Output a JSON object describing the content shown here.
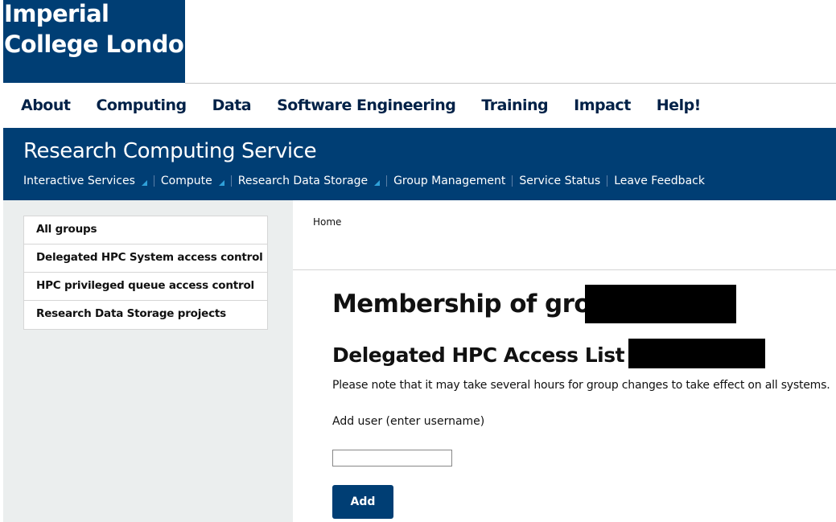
{
  "brand": {
    "logo_line1": "Imperial",
    "logo_line2": "College London",
    "color": "#003e74"
  },
  "main_nav": {
    "items": [
      "About",
      "Computing",
      "Data",
      "Software Engineering",
      "Training",
      "Impact",
      "Help!"
    ]
  },
  "service": {
    "title": "Research Computing Service",
    "subnav": [
      {
        "label": "Interactive Services",
        "dropdown": true
      },
      {
        "label": "Compute",
        "dropdown": true
      },
      {
        "label": "Research Data Storage",
        "dropdown": true
      },
      {
        "label": "Group Management",
        "dropdown": false
      },
      {
        "label": "Service Status",
        "dropdown": false
      },
      {
        "label": "Leave Feedback",
        "dropdown": false
      }
    ],
    "dropdown_icon_color": "#2fa0d8"
  },
  "sidebar": {
    "items": [
      "All groups",
      "Delegated HPC System access control",
      "HPC privileged queue access control",
      "Research Data Storage projects"
    ]
  },
  "breadcrumb": {
    "home": "Home"
  },
  "content": {
    "heading": "Membership of group",
    "subheading": "Delegated HPC Access List for",
    "note": "Please note that it may take several hours for group changes to take effect on all systems.",
    "add_user_label": "Add user (enter username)",
    "username_value": "",
    "add_button_label": "Add"
  }
}
